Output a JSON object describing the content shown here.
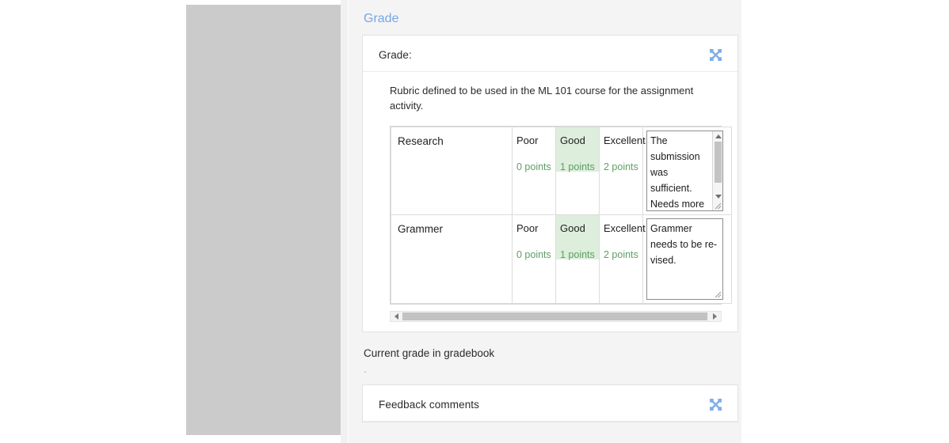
{
  "region": {
    "heading": "Grade"
  },
  "grade_card": {
    "title": "Grade:",
    "expand_icon": "expand-arrows-icon",
    "rubric_description": "Rubric defined to be used in the ML 101 course for the assignment activity.",
    "rubric": {
      "levels": [
        "Poor",
        "Good",
        "Excellent"
      ],
      "points": [
        "0 points",
        "1 points",
        "2 points"
      ],
      "selected_level": "Good",
      "rows": [
        {
          "criterion": "Research",
          "levels": [
            "Poor",
            "Good",
            "Excellent"
          ],
          "points": [
            "0 points",
            "1 points",
            "2 points"
          ],
          "selected_index": 1,
          "remark": "The submission was sufficient. Needs more"
        },
        {
          "criterion": "Grammer",
          "levels": [
            "Poor",
            "Good",
            "Excellent"
          ],
          "points": [
            "0 points",
            "1 points",
            "2 points"
          ],
          "selected_index": 1,
          "remark": "Grammer needs to be re-\nvised."
        }
      ]
    },
    "horizontal_scrollbar": {
      "left_arrow": "caret-left-icon",
      "right_arrow": "caret-right-icon"
    }
  },
  "gradebook": {
    "label": "Current grade in gradebook",
    "value": "-"
  },
  "feedback_card": {
    "title": "Feedback comments",
    "expand_icon": "expand-arrows-icon"
  },
  "colors": {
    "accent_link": "#76a7e3",
    "selected_level_bg": "#ddeedd",
    "points_text": "#5e9e62",
    "page_bg": "#f4f4f4",
    "left_panel": "#cbcbcb"
  }
}
